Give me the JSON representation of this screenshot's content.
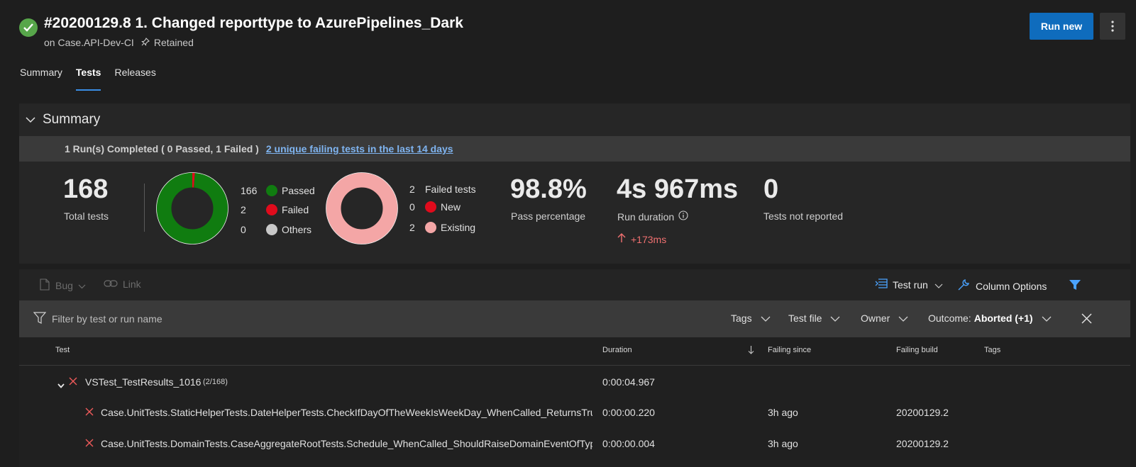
{
  "header": {
    "title": "#20200129.8 1. Changed reporttype to AzurePipelines_Dark",
    "pipeline": "on Case.API-Dev-CI",
    "retained": "Retained",
    "run_new": "Run new"
  },
  "tabs": [
    {
      "label": "Summary",
      "active": false
    },
    {
      "label": "Tests",
      "active": true
    },
    {
      "label": "Releases",
      "active": false
    }
  ],
  "summary": {
    "heading": "Summary",
    "runs_completed": "1 Run(s) Completed ( 0 Passed, 1 Failed )",
    "failing_link": "2 unique failing tests in the last 14 days",
    "total_tests": "168",
    "total_tests_label": "Total tests",
    "outcome_chart": {
      "passed": 166,
      "failed": 2,
      "others": 0,
      "labels": {
        "passed": "Passed",
        "failed": "Failed",
        "others": "Others"
      },
      "colors": {
        "passed": "#107c10",
        "failed": "#e00b1c",
        "others": "#c8c8c8"
      }
    },
    "failed_chart": {
      "failed_total": 2,
      "new": 0,
      "existing": 2,
      "labels": {
        "failed_total": "Failed tests",
        "new": "New",
        "existing": "Existing"
      },
      "colors": {
        "new": "#e00b1c",
        "existing": "#f4a6a6"
      }
    },
    "pass_percentage": "98.8%",
    "pass_percentage_label": "Pass percentage",
    "run_duration": "4s 967ms",
    "run_duration_label": "Run duration",
    "duration_delta": "+173ms",
    "not_reported": "0",
    "not_reported_label": "Tests not reported"
  },
  "toolbar": {
    "bug": "Bug",
    "link": "Link",
    "test_run": "Test run",
    "column_options": "Column Options"
  },
  "filter": {
    "placeholder": "Filter by test or run name",
    "tags": "Tags",
    "test_file": "Test file",
    "owner": "Owner",
    "outcome_label": "Outcome:",
    "outcome_value": "Aborted (+1)"
  },
  "table": {
    "columns": {
      "test": "Test",
      "duration": "Duration",
      "failing_since": "Failing since",
      "failing_build": "Failing build",
      "tags": "Tags"
    },
    "group": {
      "name": "VSTest_TestResults_1016",
      "count": "(2/168)",
      "duration": "0:00:04.967"
    },
    "rows": [
      {
        "name": "Case.UnitTests.StaticHelperTests.DateHelperTests.CheckIfDayOfTheWeekIsWeekDay_WhenCalled_ReturnsTrue",
        "duration": "0:00:00.220",
        "failing_since": "3h ago",
        "failing_build": "20200129.2"
      },
      {
        "name": "Case.UnitTests.DomainTests.CaseAggregateRootTests.Schedule_WhenCalled_ShouldRaiseDomainEventOfType",
        "duration": "0:00:00.004",
        "failing_since": "3h ago",
        "failing_build": "20200129.2"
      }
    ]
  }
}
